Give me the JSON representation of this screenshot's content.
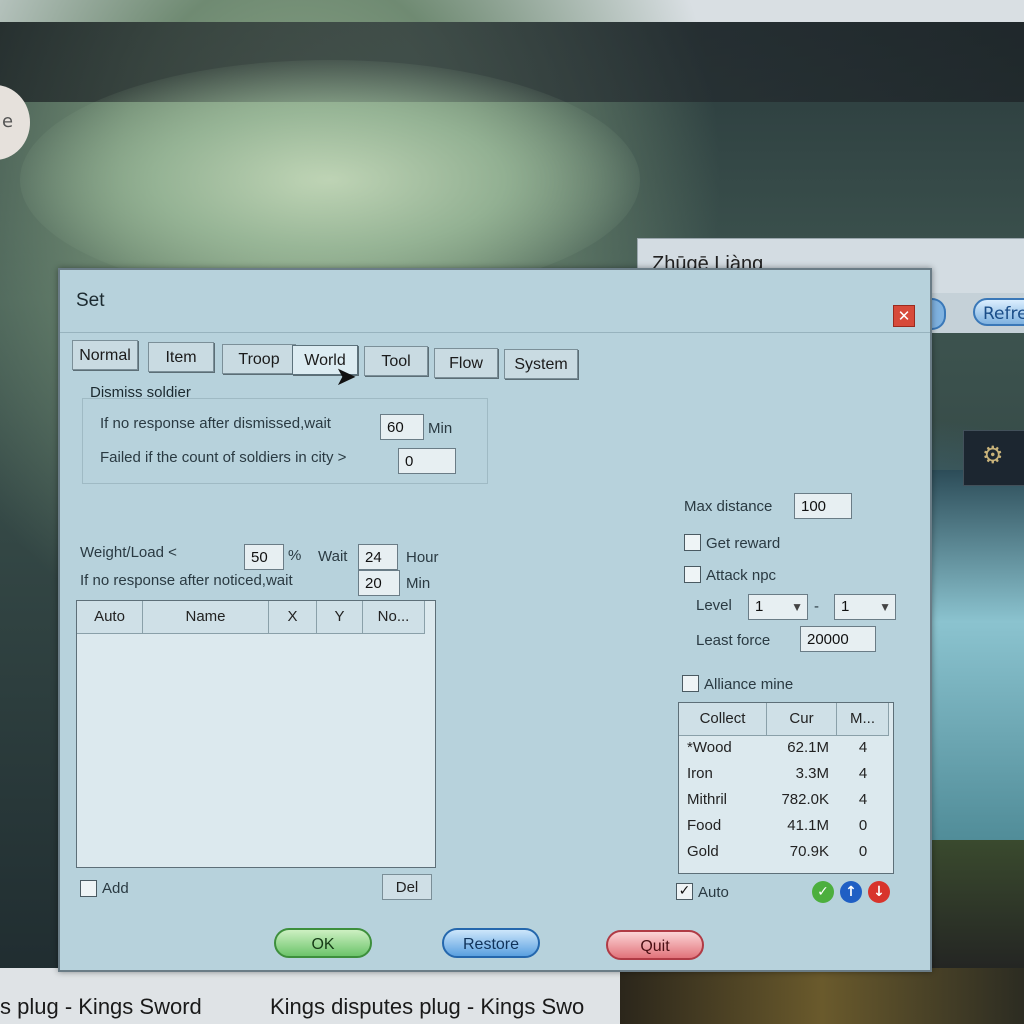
{
  "background": {
    "circle_text": "e",
    "back_window": {
      "title": "Zhūgē Liàng",
      "refresh_label": "Refres"
    },
    "taskbar": [
      "s plug - Kings Sword",
      "Kings disputes plug - Kings Swo"
    ]
  },
  "dialog": {
    "title": "Set",
    "close_glyph": "✕",
    "tabs": [
      "Normal",
      "Item",
      "Troop",
      "World",
      "Tool",
      "Flow",
      "System"
    ],
    "active_tab": "World",
    "dismiss": {
      "heading": "Dismiss soldier",
      "wait_label": "If no response after dismissed,wait",
      "wait_value": "60",
      "wait_unit": "Min",
      "failed_label": "Failed if the count of soldiers in city >",
      "failed_value": "0"
    },
    "weight": {
      "label": "Weight/Load <",
      "value": "50",
      "percent": "%",
      "wait_label": "Wait",
      "wait_value": "24",
      "wait_unit": "Hour"
    },
    "notice": {
      "label": "If no response after noticed,wait",
      "value": "20",
      "unit": "Min"
    },
    "target_list": {
      "columns": [
        "Auto",
        "Name",
        "X",
        "Y",
        "No..."
      ],
      "rows": []
    },
    "add_label": "Add",
    "add_checked": false,
    "del_label": "Del",
    "max_distance": {
      "label": "Max distance",
      "value": "100"
    },
    "get_reward": {
      "label": "Get reward",
      "checked": false
    },
    "attack_npc": {
      "label": "Attack npc",
      "checked": false
    },
    "level": {
      "label": "Level",
      "from": "1",
      "dash": "-",
      "to": "1"
    },
    "least_force": {
      "label": "Least force",
      "value": "20000"
    },
    "alliance_mine": {
      "label": "Alliance mine",
      "checked": false
    },
    "resources": {
      "columns": [
        "Collect",
        "Cur",
        "M..."
      ],
      "rows": [
        {
          "name": "*Wood",
          "cur": "62.1M",
          "m": "4"
        },
        {
          "name": "Iron",
          "cur": "3.3M",
          "m": "4"
        },
        {
          "name": "Mithril",
          "cur": "782.0K",
          "m": "4"
        },
        {
          "name": "Food",
          "cur": "41.1M",
          "m": "0"
        },
        {
          "name": "Gold",
          "cur": "70.9K",
          "m": "0"
        }
      ]
    },
    "auto": {
      "label": "Auto",
      "checked": true,
      "check_glyph": "✓"
    },
    "action_icons": {
      "confirm": "✓",
      "up": "↑",
      "down": "↓"
    },
    "buttons": {
      "ok": "OK",
      "restore": "Restore",
      "quit": "Quit"
    },
    "colors": {
      "confirm": "#4caf3e",
      "up": "#1f5fc4",
      "down": "#d8342c"
    }
  }
}
